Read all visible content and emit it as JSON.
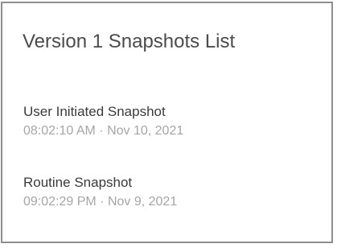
{
  "panel": {
    "title": "Version 1 Snapshots List"
  },
  "snapshots": [
    {
      "name": "User Initiated Snapshot",
      "timestamp": "08:02:10 AM · Nov 10, 2021"
    },
    {
      "name": "Routine Snapshot",
      "timestamp": "09:02:29 PM · Nov 9, 2021"
    }
  ],
  "colors": {
    "border": "#8e8e8e",
    "title": "#4b4b4b",
    "snapshot_name": "#3a3a3a",
    "timestamp": "#a6a6a6"
  }
}
